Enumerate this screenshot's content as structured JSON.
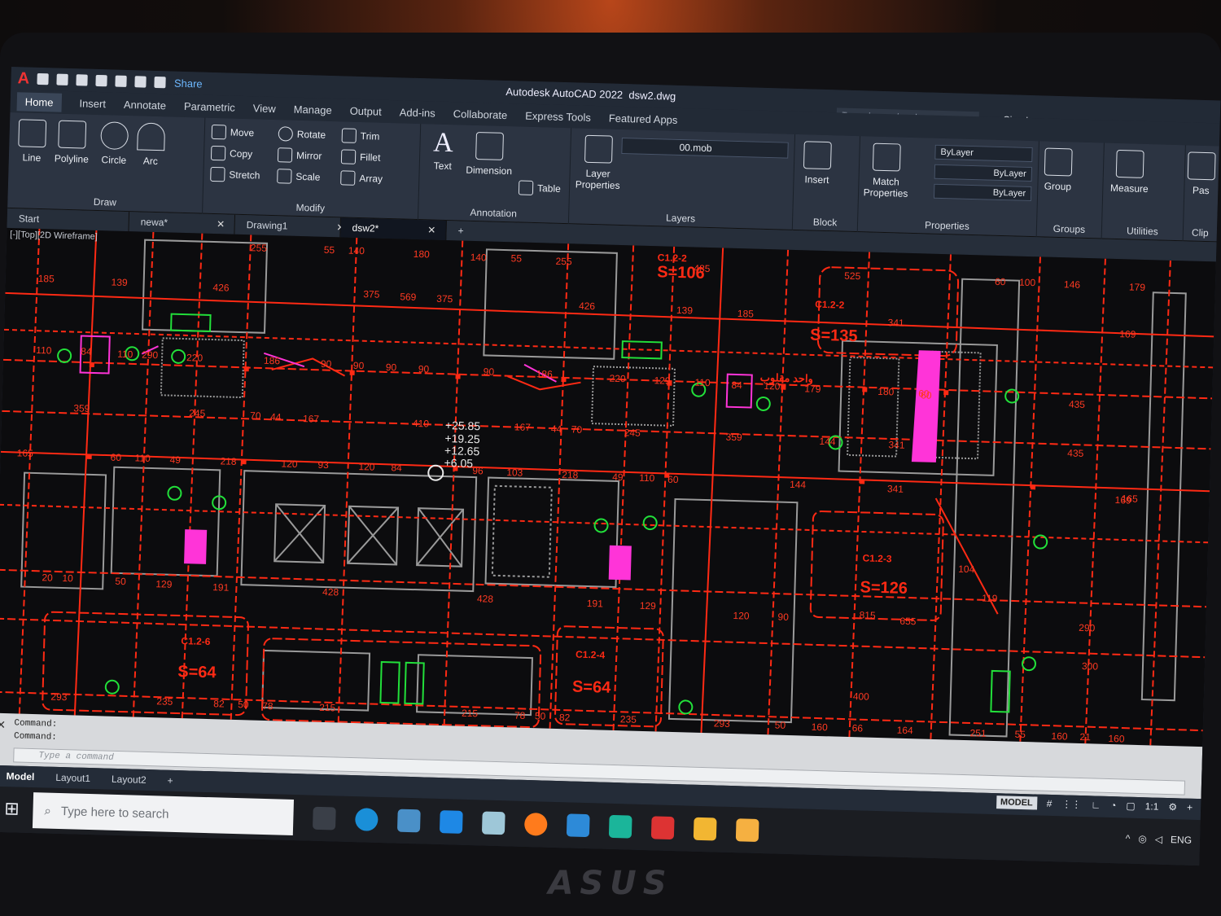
{
  "app": {
    "title": "Autodesk AutoCAD 2022",
    "file": "dsw2.dwg",
    "share": "Share",
    "search_placeholder": "Type a keyword or phrase",
    "sign_in": "Sign In"
  },
  "ribbon_tabs": [
    "Home",
    "Insert",
    "Annotate",
    "Parametric",
    "View",
    "Manage",
    "Output",
    "Add-ins",
    "Collaborate",
    "Express Tools",
    "Featured Apps"
  ],
  "draw": {
    "title": "Draw",
    "line": "Line",
    "polyline": "Polyline",
    "circle": "Circle",
    "arc": "Arc"
  },
  "modify": {
    "title": "Modify",
    "move": "Move",
    "rotate": "Rotate",
    "trim": "Trim",
    "copy": "Copy",
    "mirror": "Mirror",
    "fillet": "Fillet",
    "stretch": "Stretch",
    "scale": "Scale",
    "array": "Array"
  },
  "annotation": {
    "title": "Annotation",
    "text": "Text",
    "dimension": "Dimension",
    "table": "Table"
  },
  "layers": {
    "title": "Layers",
    "layer_properties": "Layer Properties",
    "current_layer": "00.mob"
  },
  "block": {
    "title": "Block",
    "insert": "Insert"
  },
  "properties": {
    "title": "Properties",
    "match": "Match Properties",
    "color": "ByLayer",
    "linetype": "ByLayer",
    "lineweight": "ByLayer"
  },
  "groups": {
    "title": "Groups",
    "group": "Group"
  },
  "utilities": {
    "title": "Utilities",
    "measure": "Measure"
  },
  "clip": {
    "paste": "Pas",
    "title": "Clip"
  },
  "file_tabs": [
    "Start",
    "newa*",
    "Drawing1",
    "dsw2*"
  ],
  "view_label": "[-][Top][2D Wireframe]",
  "drawing": {
    "room_labels": [
      "S=106",
      "S=135",
      "S=126",
      "S=64",
      "S=64"
    ],
    "room_codes": [
      "C1.2-2",
      "C1.2-2",
      "C1.2-3",
      "C1.2-6",
      "C1.2-4"
    ],
    "elevations": [
      "+25.85",
      "+19.25",
      "+12.65",
      "+6.05"
    ],
    "dims_top": [
      "255",
      "55",
      "140",
      "180",
      "140",
      "55",
      "255",
      "485",
      "525",
      "60",
      "100",
      "146",
      "179"
    ],
    "dims_row2": [
      "185",
      "139",
      "426",
      "375",
      "569",
      "375",
      "426",
      "139",
      "185",
      "341",
      "169",
      "169"
    ],
    "dims_row3": [
      "110",
      "84",
      "110",
      "290",
      "220",
      "186",
      "90",
      "90",
      "90",
      "90",
      "90",
      "186",
      "220",
      "129",
      "110",
      "84",
      "120",
      "179",
      "180",
      "60",
      "435"
    ],
    "dims_row4": [
      "359",
      "245",
      "70",
      "44",
      "167",
      "410",
      "167",
      "44",
      "70",
      "245",
      "359",
      "144",
      "341",
      "435"
    ],
    "dims_row5": [
      "165",
      "60",
      "110",
      "49",
      "218",
      "120",
      "93",
      "120",
      "84",
      "96",
      "103",
      "218",
      "49",
      "110",
      "60",
      "144",
      "341",
      "165"
    ],
    "dims_bottom": [
      "293",
      "235",
      "82",
      "50",
      "78",
      "215",
      "215",
      "78",
      "50",
      "82",
      "235",
      "293",
      "50",
      "160",
      "66",
      "164",
      "251",
      "55",
      "160",
      "21",
      "160"
    ],
    "dims_misc": [
      "428",
      "428",
      "191",
      "191",
      "129",
      "129",
      "655",
      "815",
      "400",
      "300",
      "290",
      "104",
      "119",
      "20",
      "10",
      "50",
      "60",
      "120",
      "90"
    ],
    "arabic_note": "واحد مقلوب"
  },
  "command": {
    "history": [
      "Command:",
      "Command:"
    ],
    "placeholder": "Type a command"
  },
  "layout_tabs": [
    "Model",
    "Layout1",
    "Layout2"
  ],
  "status": {
    "model": "MODEL",
    "scale": "1:1"
  },
  "taskbar": {
    "search": "Type here to search",
    "lang": "ENG"
  },
  "brand": "ASUS",
  "colors": {
    "red": "#ff2a14",
    "green": "#22e03a",
    "magenta": "#ff34d8",
    "grey": "#9a9a9a",
    "cad_bg": "#0c0c0e"
  }
}
